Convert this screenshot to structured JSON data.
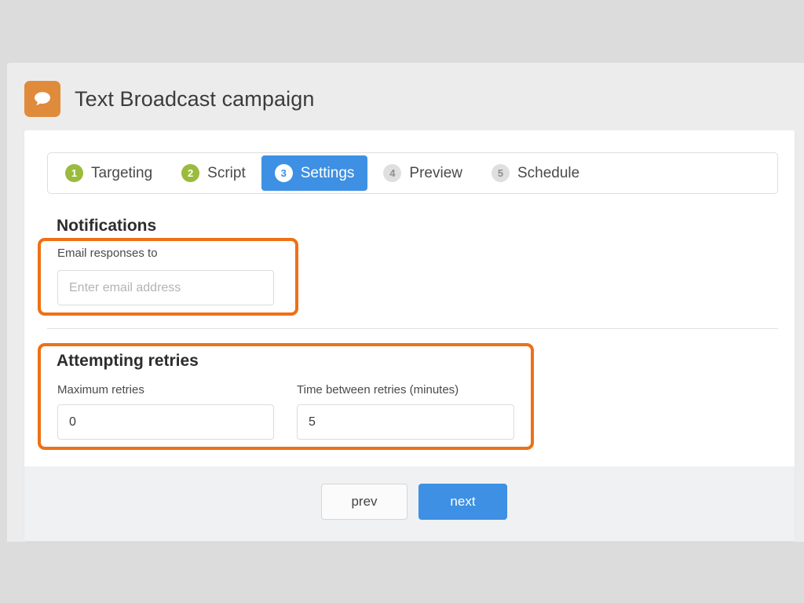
{
  "colors": {
    "accent_orange": "#e08b3c",
    "annotation_orange": "#ee7014",
    "active_blue": "#3d90e3",
    "done_green": "#9bbb3c",
    "page_background": "#dcdcdc",
    "band_background": "#ececec",
    "card_background": "#ffffff",
    "footer_background": "#f0f1f2"
  },
  "header": {
    "icon": "speech-bubble-icon",
    "title": "Text Broadcast campaign"
  },
  "wizard": {
    "steps": [
      {
        "number": "1",
        "label": "Targeting",
        "state": "done"
      },
      {
        "number": "2",
        "label": "Script",
        "state": "done"
      },
      {
        "number": "3",
        "label": "Settings",
        "state": "active"
      },
      {
        "number": "4",
        "label": "Preview",
        "state": "todo"
      },
      {
        "number": "5",
        "label": "Schedule",
        "state": "todo"
      }
    ]
  },
  "notifications": {
    "heading": "Notifications",
    "email_label": "Email responses to",
    "email_value": "",
    "email_placeholder": "Enter email address"
  },
  "retries": {
    "heading": "Attempting retries",
    "max_label": "Maximum retries",
    "max_value": "0",
    "interval_label": "Time between retries (minutes)",
    "interval_value": "5"
  },
  "footer": {
    "prev_label": "prev",
    "next_label": "next"
  }
}
